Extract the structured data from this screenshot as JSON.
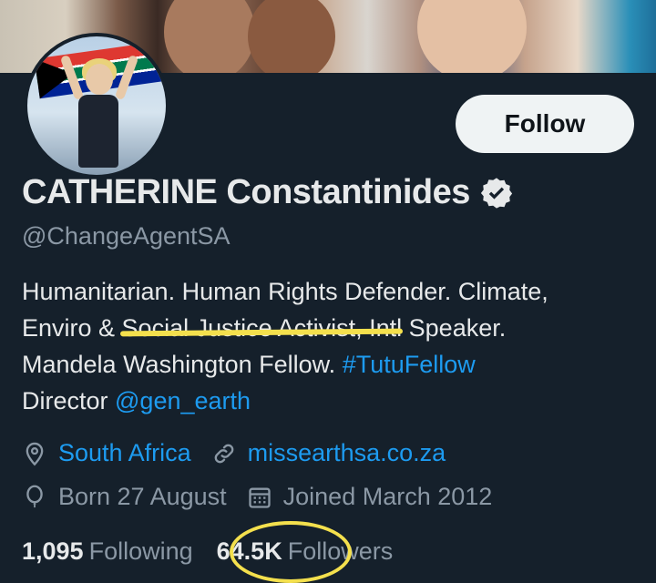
{
  "profile": {
    "name": "CATHERINE Constantinides",
    "handle": "@ChangeAgentSA",
    "follow_label": "Follow",
    "bio": {
      "line1": "Humanitarian. Human Rights Defender. Climate,",
      "line2_pre": "Enviro & ",
      "line2_mark": "Social Justice Activist,",
      "line2_post": " Intl Speaker.",
      "line3_pre": "Mandela Washington Fellow. ",
      "line3_hashtag": "#TutuFellow",
      "line4_pre": "Director ",
      "line4_mention": "@gen_earth"
    },
    "location": "South Africa",
    "website": "missearthsa.co.za",
    "birthday": "Born 27 August",
    "joined": "Joined March 2012",
    "following_count": "1,095",
    "following_label": "Following",
    "followers_count": "64.5K",
    "followers_label": "Followers"
  },
  "icons": {
    "verified": "verified-badge-icon",
    "location": "location-pin-icon",
    "link": "link-icon",
    "birthday": "balloon-icon",
    "calendar": "calendar-icon"
  },
  "colors": {
    "background": "#15202b",
    "link": "#1d9bf0",
    "secondary_text": "#8b98a5",
    "annotation": "#f4e04d"
  }
}
